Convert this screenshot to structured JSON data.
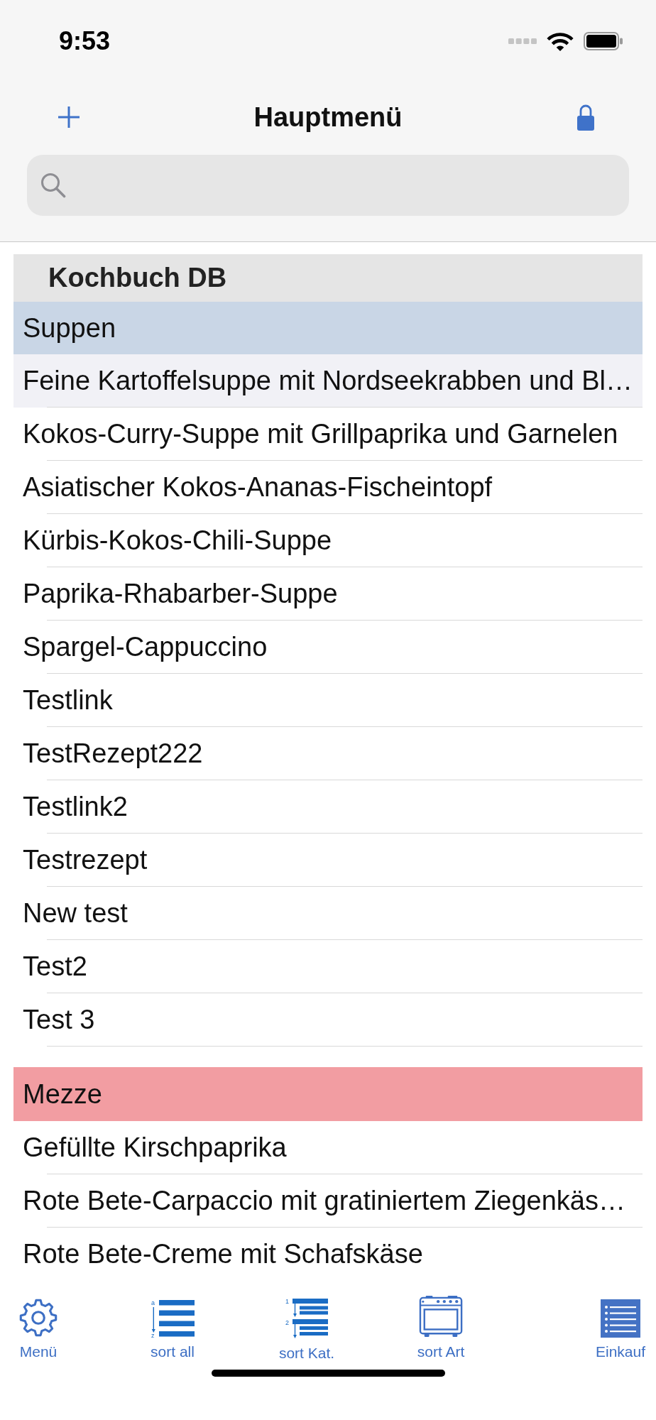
{
  "status_bar": {
    "time": "9:53"
  },
  "nav_bar": {
    "title": "Hauptmenü"
  },
  "list": {
    "title": "Kochbuch DB",
    "sections": [
      {
        "name": "Suppen",
        "color": "#c9d6e6",
        "items": [
          {
            "label": "Feine Kartoffelsuppe mit Nordseekrabben und Bl…",
            "selected": true
          },
          {
            "label": "Kokos-Curry-Suppe mit Grillpaprika und Garnelen",
            "selected": false
          },
          {
            "label": "Asiatischer Kokos-Ananas-Fischeintopf",
            "selected": false
          },
          {
            "label": "Kürbis-Kokos-Chili-Suppe",
            "selected": false
          },
          {
            "label": "Paprika-Rhabarber-Suppe",
            "selected": false
          },
          {
            "label": "Spargel-Cappuccino",
            "selected": false
          },
          {
            "label": "Testlink",
            "selected": false
          },
          {
            "label": "TestRezept222",
            "selected": false
          },
          {
            "label": "Testlink2",
            "selected": false
          },
          {
            "label": "Testrezept",
            "selected": false
          },
          {
            "label": "New test",
            "selected": false
          },
          {
            "label": "Test2",
            "selected": false
          },
          {
            "label": "Test 3",
            "selected": false
          }
        ]
      },
      {
        "name": "Mezze",
        "color": "#f29da2",
        "items": [
          {
            "label": "Gefüllte Kirschpaprika",
            "selected": false
          },
          {
            "label": "Rote Bete-Carpaccio mit gratiniertem Ziegenkäs…",
            "selected": false
          },
          {
            "label": "Rote Bete-Creme mit Schafskäse",
            "selected": false
          }
        ]
      }
    ]
  },
  "tab_bar": [
    {
      "label": "Menü",
      "kind": "gear"
    },
    {
      "label": "sort all",
      "kind": "sort-all",
      "icon_text": [
        "a",
        "z"
      ]
    },
    {
      "label": "sort Kat.",
      "kind": "sort-category",
      "icon_text": [
        "1",
        "2"
      ]
    },
    {
      "label": "sort Art",
      "kind": "oven"
    },
    {
      "label": "Einkauf",
      "kind": "list"
    }
  ]
}
